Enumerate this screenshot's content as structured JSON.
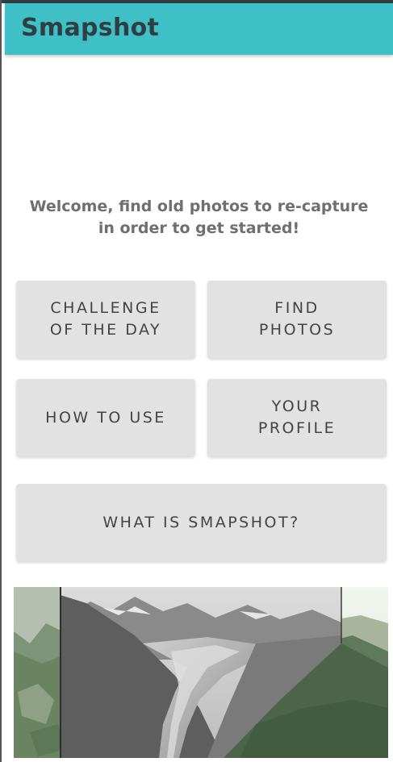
{
  "app": {
    "title": "Smapshot",
    "accent_color": "#3ec0c6"
  },
  "welcome": {
    "line1": "Welcome, find old photos to re-capture",
    "line2": "in order to get started!"
  },
  "buttons": {
    "challenge": "CHALLENGE\nOF THE DAY",
    "find_photos": "FIND\nPHOTOS",
    "how_to_use": "HOW TO USE",
    "your_profile": "YOUR\nPROFILE",
    "what_is": "WHAT IS SMAPSHOT?"
  },
  "hero_image": {
    "subject": "glacier-overlay-photo"
  }
}
